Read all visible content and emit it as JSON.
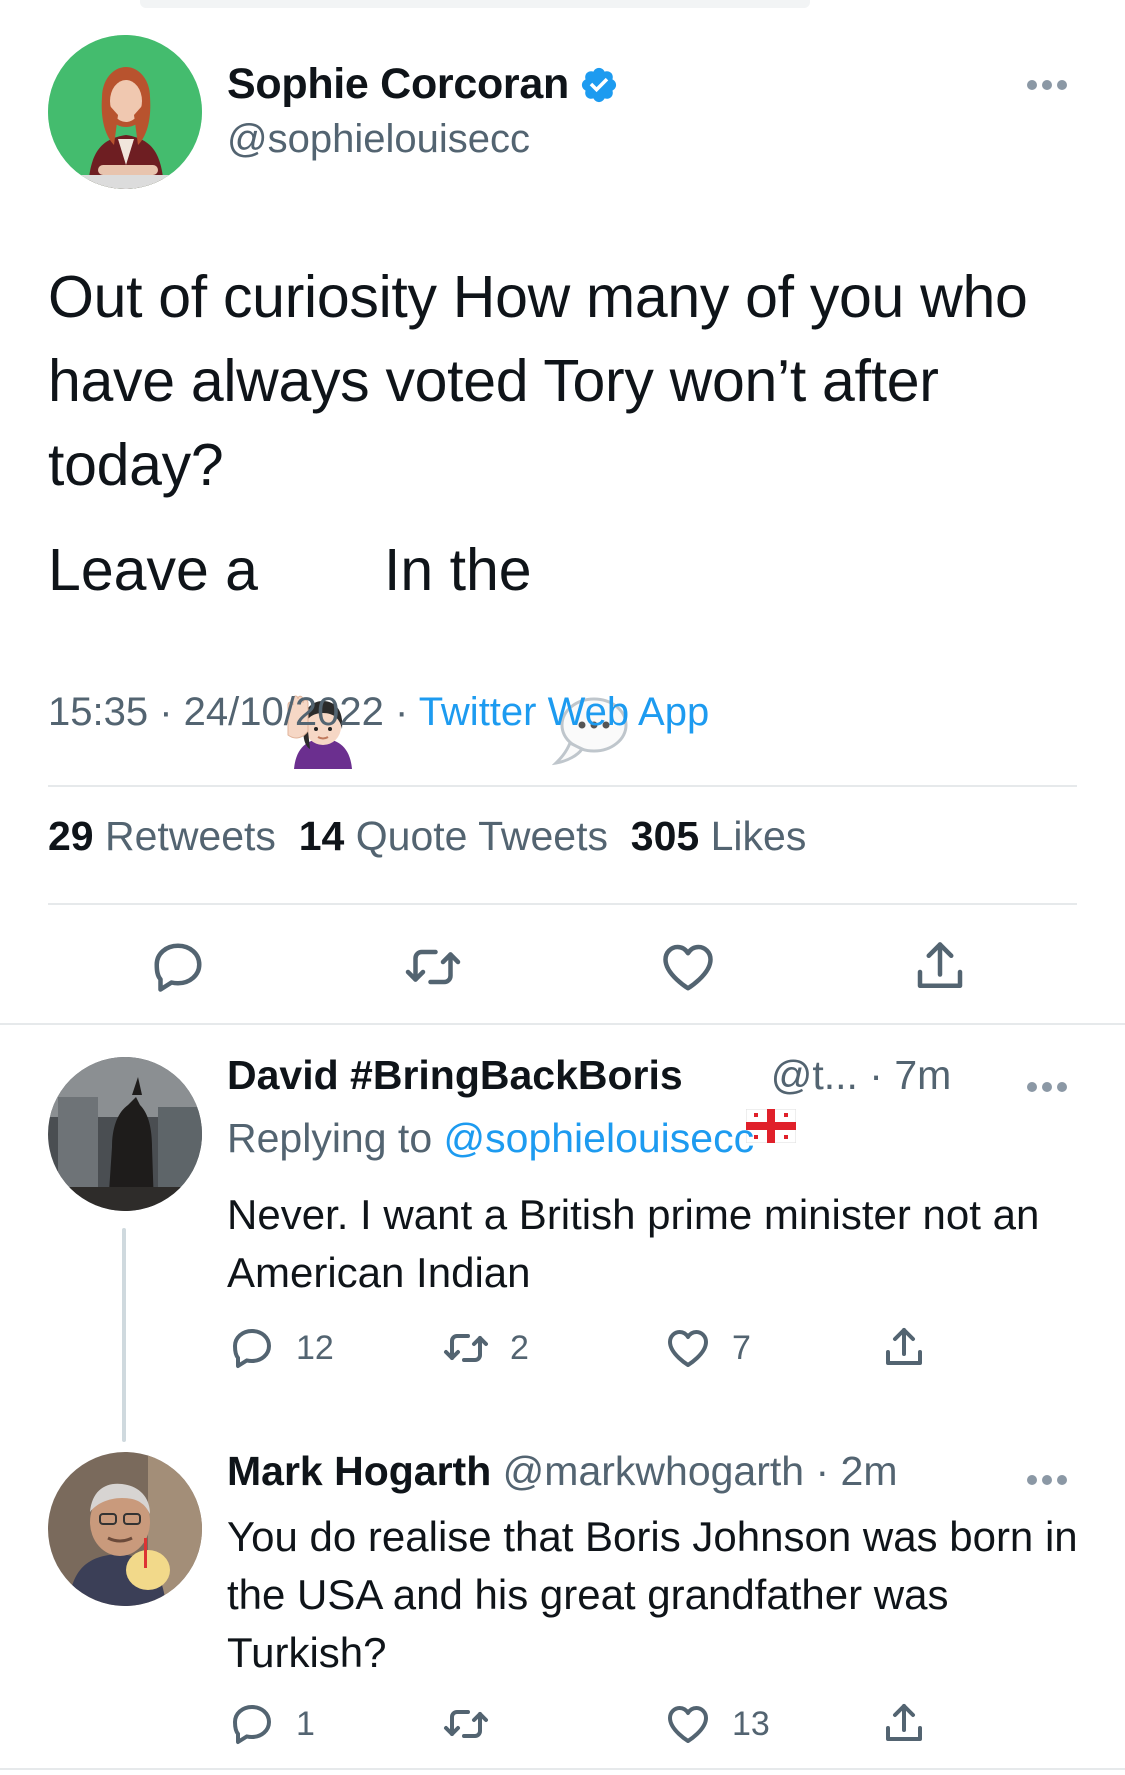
{
  "main_tweet": {
    "author_name": "Sophie Corcoran",
    "author_handle": "@sophielouisecc",
    "text": "Out of curiosity How many of you who have always voted Tory won’t after today?",
    "line2_part1": "Leave a",
    "line2_part2": "In the",
    "line2_emoji1": "raising-hand-emoji",
    "line2_emoji2": "speech-bubble-emoji",
    "time": "15:35",
    "date": "24/10/2022",
    "source": "Twitter Web App",
    "retweets_count": "29",
    "retweets_label": "Retweets",
    "quotes_count": "14",
    "quotes_label": "Quote Tweets",
    "likes_count": "305",
    "likes_label": "Likes"
  },
  "replies": [
    {
      "author_name": "David #BringBackBoris",
      "flag": "england-georgia-flag",
      "author_handle": "@t...",
      "time": "7m",
      "replying_label": "Replying to",
      "replying_handle": "@sophielouisecc",
      "text": "Never.  I want a British prime minister not an American Indian",
      "reply_count": "12",
      "retweet_count": "2",
      "like_count": "7"
    },
    {
      "author_name": "Mark Hogarth",
      "author_handle": "@markwhogarth",
      "time": "2m",
      "text": "You do realise that Boris Johnson was born in the USA and his great grandfather was Turkish?",
      "reply_count": "1",
      "retweet_count": "",
      "like_count": "13"
    }
  ],
  "colors": {
    "accent": "#1d9bf0",
    "text": "#0f1419",
    "secondary": "#536471",
    "divider": "#e6e9eb"
  }
}
